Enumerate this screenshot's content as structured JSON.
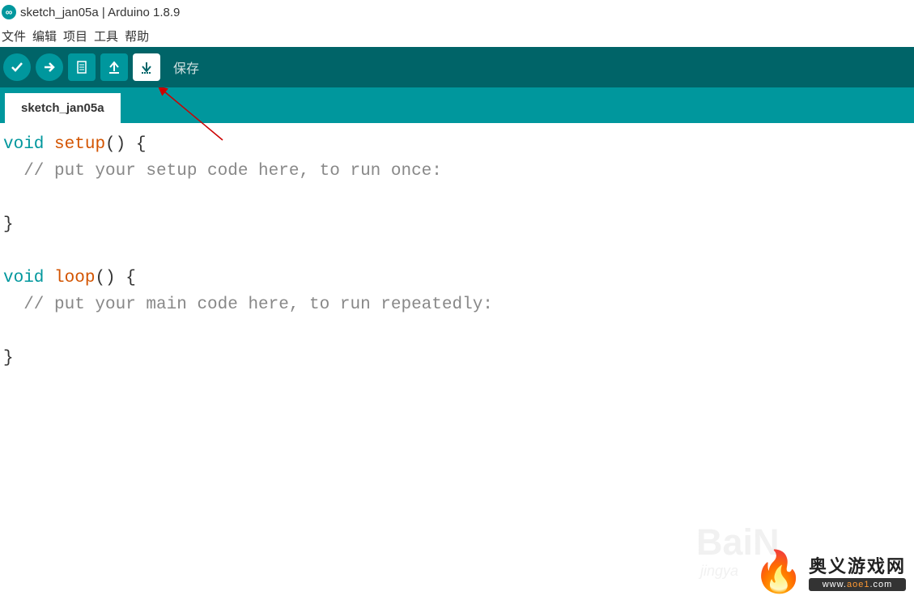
{
  "window": {
    "title": "sketch_jan05a | Arduino 1.8.9"
  },
  "menu": {
    "file": "文件",
    "edit": "编辑",
    "project": "项目",
    "tools": "工具",
    "help": "帮助"
  },
  "toolbar": {
    "save_tooltip": "保存"
  },
  "tabs": {
    "active": "sketch_jan05a"
  },
  "code": {
    "line1_kw": "void",
    "line1_fn": "setup",
    "line1_rest": "() {",
    "line2_comment": "  // put your setup code here, to run once:",
    "line4": "}",
    "line6_kw": "void",
    "line6_fn": "loop",
    "line6_rest": "() {",
    "line7_comment": "  // put your main code here, to run repeatedly:",
    "line9": "}"
  },
  "watermark": {
    "baidu": "BaiN",
    "baidu_sub": "jingya",
    "site_cn": "奥义游戏网",
    "site_en_prefix": "www.",
    "site_en_domain": "aoe1",
    "site_en_suffix": ".com"
  }
}
